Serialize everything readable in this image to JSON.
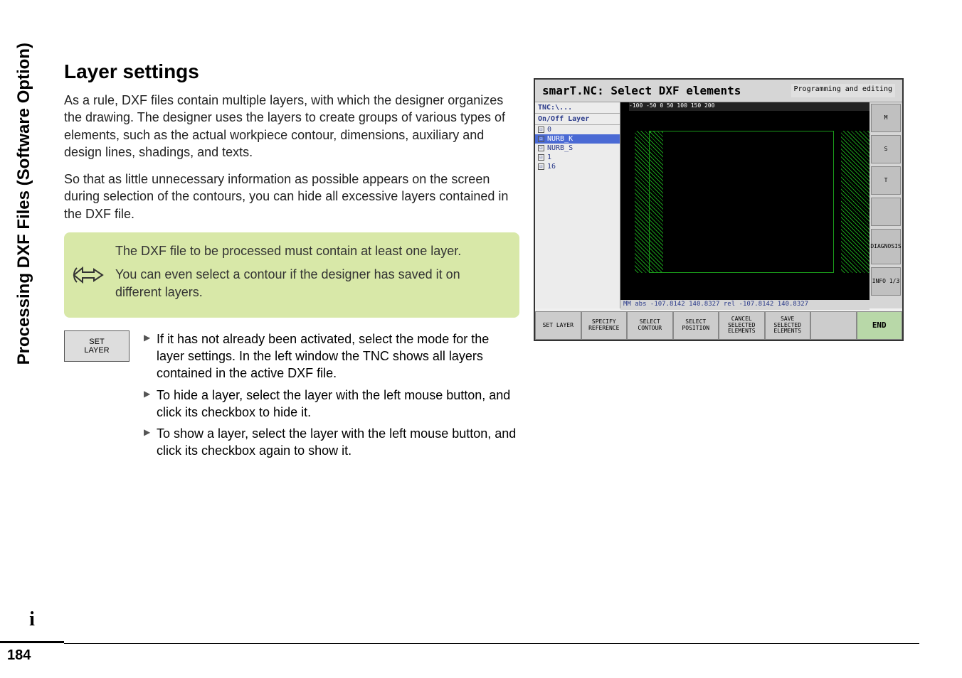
{
  "sidebar": {
    "label": "Processing DXF Files (Software Option)"
  },
  "heading": "Layer settings",
  "paragraphs": {
    "p1": "As a rule, DXF files contain multiple layers, with which the designer organizes the drawing. The designer uses the layers to create groups of various types of elements, such as the actual workpiece contour, dimensions, auxiliary and design lines, shadings, and texts.",
    "p2": "So that as little unnecessary information as possible appears on the screen during selection of the contours, you can hide all excessive layers contained in the DXF file."
  },
  "note": {
    "line1": "The DXF file to be processed must contain at least one layer.",
    "line2": "You can even select a contour if the designer has saved it on different layers."
  },
  "softkey": {
    "line1": "SET",
    "line2": "LAYER"
  },
  "instructions": {
    "i1": "If it has not already been activated, select the mode for the layer settings. In the left window the TNC shows all layers contained in the active DXF file.",
    "i2": "To hide a layer, select the layer with the left mouse button, and click its checkbox to hide it.",
    "i3": "To show a layer, select the layer with the left mouse button, and click its checkbox again to show it."
  },
  "screenshot": {
    "title": "smarT.NC: Select DXF elements",
    "mode": "Programming and editing",
    "tnc_path": "TNC:\\...",
    "layer_header": "On/Off Layer",
    "ruler": "-100     -50      0       50      100     150    200",
    "layers": [
      {
        "checked": true,
        "name": "0"
      },
      {
        "checked": true,
        "name": "NURB_K",
        "selected": true
      },
      {
        "checked": true,
        "name": "NURB_S"
      },
      {
        "checked": true,
        "name": "1"
      },
      {
        "checked": true,
        "name": "16"
      }
    ],
    "status": "MM   abs -107.8142 140.8327 rel -107.8142 140.8327",
    "right_buttons": {
      "m": "M",
      "s": "S",
      "t": "T",
      "diag": "DIAGNOSIS",
      "info": "INFO 1/3"
    },
    "softkeys": [
      "SET LAYER",
      "SPECIFY REFERENCE",
      "SELECT CONTOUR",
      "SELECT POSITION",
      "CANCEL SELECTED ELEMENTS",
      "SAVE SELECTED ELEMENTS",
      "",
      "END"
    ]
  },
  "footer": {
    "page": "184",
    "info": "i"
  }
}
